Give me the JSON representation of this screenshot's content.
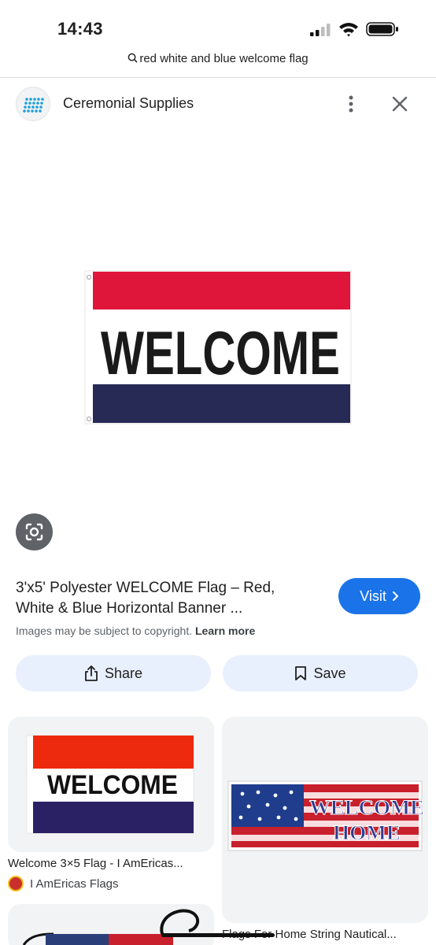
{
  "status": {
    "time": "14:43"
  },
  "search": {
    "query": "red white and blue welcome flag"
  },
  "source": {
    "name": "Ceremonial Supplies"
  },
  "main_image": {
    "flag_text": "WELCOME",
    "colors": {
      "red": "#e0153a",
      "white": "#ffffff",
      "blue": "#262a55"
    }
  },
  "result": {
    "title_line1": "3'x5' Polyester WELCOME Flag – Red,",
    "title_line2": "White & Blue Horizontal Banner ...",
    "visit_label": "Visit",
    "copyright_text": "Images may be subject to copyright.",
    "learn_more": "Learn more"
  },
  "actions": {
    "share_label": "Share",
    "save_label": "Save"
  },
  "related": [
    {
      "title": "Welcome 3×5 Flag - I AmEricas...",
      "source": "I AmEricas Flags",
      "flag_text": "WELCOME"
    },
    {
      "title": "Flags For Home String Nautical...",
      "flag_text_line1": "WELCOME",
      "flag_text_line2": "HOME"
    }
  ],
  "colors": {
    "accent": "#1a73e8",
    "chip_bg": "#e8f0fe"
  }
}
